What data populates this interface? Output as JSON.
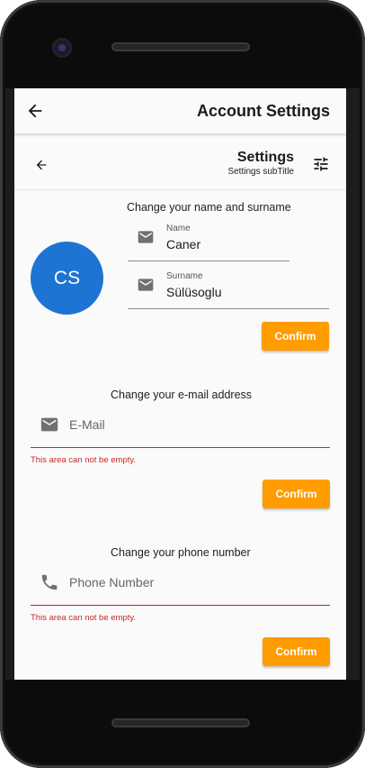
{
  "appbar": {
    "title": "Account Settings"
  },
  "settings_header": {
    "title": "Settings",
    "subtitle": "Settings subTitle"
  },
  "name_section": {
    "title": "Change your name and surname",
    "avatar_initials": "CS",
    "name_label": "Name",
    "name_value": "Caner",
    "surname_label": "Surname",
    "surname_value": "Sülüsoglu",
    "confirm_label": "Confirm"
  },
  "email_section": {
    "title": "Change your e-mail address",
    "placeholder": "E-Mail",
    "error": "This area can not be empty.",
    "confirm_label": "Confirm"
  },
  "phone_section": {
    "title": "Change your phone number",
    "placeholder": "Phone Number",
    "error": "This area can not be empty.",
    "confirm_label": "Confirm"
  },
  "colors": {
    "accent": "#ff9c00",
    "avatar": "#1e74d2",
    "error": "#c62828"
  },
  "icons": [
    "back-arrow-icon",
    "tune-icon",
    "mail-icon",
    "phone-icon"
  ]
}
